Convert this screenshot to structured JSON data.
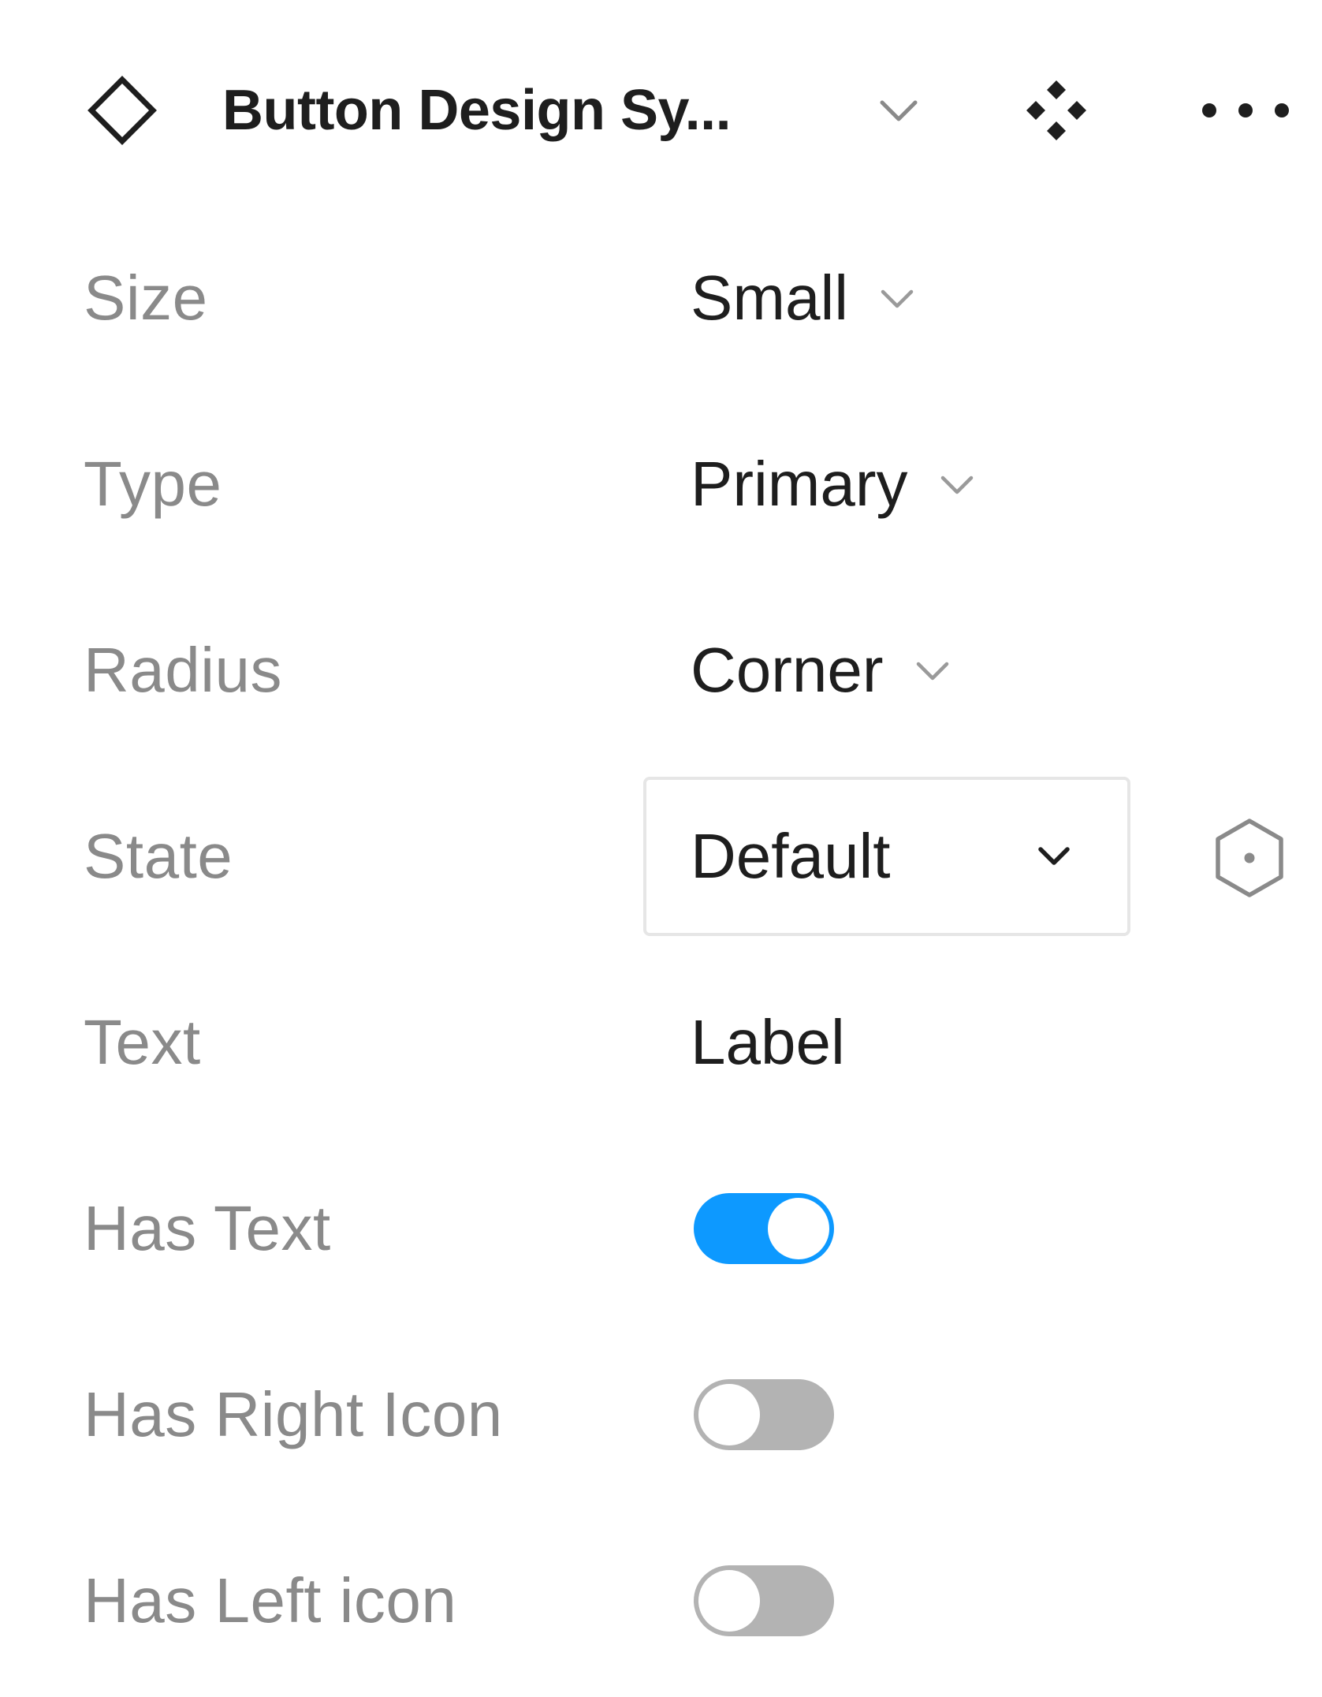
{
  "header": {
    "title": "Button Design Sy...",
    "component_icon": "component-diamond-icon",
    "title_chevron_icon": "chevron-down-icon",
    "instance_icon": "instance-diamonds-icon",
    "more_icon": "more-horizontal-icon"
  },
  "properties": {
    "size": {
      "label": "Size",
      "value": "Small"
    },
    "type": {
      "label": "Type",
      "value": "Primary"
    },
    "radius": {
      "label": "Radius",
      "value": "Corner"
    },
    "state": {
      "label": "State",
      "value": "Default",
      "extra_icon": "variable-hexagon-icon"
    },
    "text": {
      "label": "Text",
      "value": "Label"
    },
    "has_text": {
      "label": "Has Text",
      "checked": true
    },
    "has_right_icon": {
      "label": "Has Right Icon",
      "checked": false
    },
    "has_left_icon": {
      "label": "Has Left icon",
      "checked": false
    }
  },
  "colors": {
    "toggle_on": "#0d99ff",
    "toggle_off": "#b3b3b3",
    "label_text": "#8a8a8a",
    "value_text": "#1e1e1e",
    "select_border": "#e6e6e6"
  }
}
